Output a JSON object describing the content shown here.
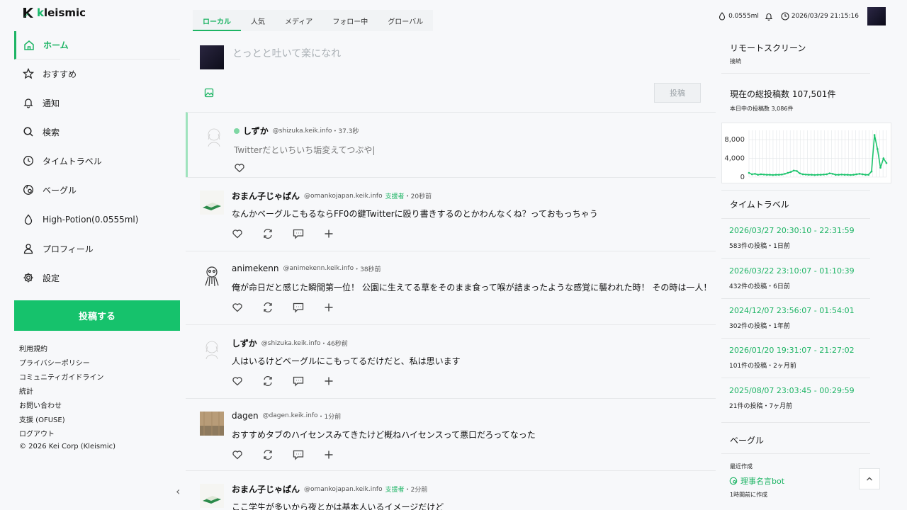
{
  "brand": {
    "logo_k": "k",
    "logo_rest": "leismic"
  },
  "nav": {
    "home": "ホーム",
    "recommended": "おすすめ",
    "notifications": "通知",
    "search": "検索",
    "time_travel": "タイムトラベル",
    "beagle": "ベーグル",
    "potion": "High-Potion(0.0555ml)",
    "profile": "プロフィール",
    "settings": "設定"
  },
  "post_button": "投稿する",
  "footer": {
    "terms": "利用規約",
    "privacy": "プライバシーポリシー",
    "guidelines": "コミュニティガイドライン",
    "stats": "統計",
    "contact": "お問い合わせ",
    "support": "支援 (OFUSE)",
    "logout": "ログアウト",
    "copyright": "© 2026 Kei Corp (Kleismic)"
  },
  "tabs": [
    "ローカル",
    "人気",
    "メディア",
    "フォロー中",
    "グローバル"
  ],
  "compose": {
    "placeholder": "とっとと吐いて楽になれ",
    "submit": "投稿"
  },
  "posts": [
    {
      "name": "しずか",
      "handle": "@shizuka.keik.info",
      "time": "・37.3秒",
      "text": "Twitterだといちいち垢変えてつぶや|"
    },
    {
      "name": "おまん子じゃぱん",
      "handle": "@omankojapan.keik.info",
      "badge": "支援者",
      "time": "・20秒前",
      "text": "なんかベーグルこもるならFF0の鍵Twitterに殴り書きするのとかわんなくね？っておもっちゃう"
    },
    {
      "name": "animekenn",
      "handle": "@animekenn.keik.info",
      "time": "・38秒前",
      "text": "俺が命日だと感じた瞬間第一位！ 公園に生えてる草をそのまま食って喉が詰まったような感覚に襲われた時！ その時は一人！"
    },
    {
      "name": "しずか",
      "handle": "@shizuka.keik.info",
      "time": "・46秒前",
      "text": "人はいるけどベーグルにこもってるだけだと、私は思います"
    },
    {
      "name": "dagen",
      "handle": "@dagen.keik.info",
      "time": "・1分前",
      "text": "おすすめタブのハイセンスみてきたけど概ねハイセンスって悪口だろってなった"
    },
    {
      "name": "おまん子じゃぱん",
      "handle": "@omankojapan.keik.info",
      "badge": "支援者",
      "time": "・2分前",
      "text": "ここ学生が多いから夜とかは基本人いるイメージだけど"
    }
  ],
  "status": {
    "potion": "0.0555ml",
    "datetime": "2026/03/29 21:15:16"
  },
  "remote": {
    "title": "リモートスクリーン",
    "status": "接続"
  },
  "totals": {
    "title": "現在の総投稿数 107,501件",
    "today": "本日中の投稿数 3,086件"
  },
  "chart_data": {
    "type": "line",
    "yticks": [
      "8,000",
      "4,000",
      "0"
    ],
    "ylim": [
      0,
      10000
    ],
    "grid": true,
    "values": [
      900,
      600,
      700,
      500,
      600,
      550,
      500,
      500,
      450,
      500,
      500,
      550,
      700,
      900,
      1100,
      1400,
      1300,
      800,
      600,
      550,
      500,
      500,
      450,
      500,
      500,
      550,
      600,
      800,
      700,
      500,
      500,
      550,
      500,
      500,
      450,
      500,
      600,
      700,
      600,
      500,
      500,
      1200,
      9000,
      6000,
      2000,
      4000,
      3000
    ]
  },
  "time_travel": {
    "title": "タイムトラベル",
    "entries": [
      {
        "range": "2026/03/27 20:30:10 - 22:31:59",
        "info": "583件の投稿・1日前"
      },
      {
        "range": "2026/03/22 23:10:07 - 01:10:39",
        "info": "432件の投稿・6日前"
      },
      {
        "range": "2024/12/07 23:56:07 - 01:54:01",
        "info": "302件の投稿・1年前"
      },
      {
        "range": "2026/01/20 19:31:07 - 21:27:02",
        "info": "101件の投稿・2ヶ月前"
      },
      {
        "range": "2025/08/07 23:03:45 - 00:29:59",
        "info": "21件の投稿・7ヶ月前"
      }
    ]
  },
  "beagle": {
    "title": "ベーグル",
    "recent": "最近作成",
    "item": "理事名言bot",
    "item_time": "1時間前に作成"
  },
  "colors": {
    "accent": "#16c26c"
  },
  "icons": [
    "home-icon",
    "star-icon",
    "bell-icon",
    "search-icon",
    "clock-icon",
    "beagle-icon",
    "drop-icon",
    "person-icon",
    "gear-icon",
    "heart-icon",
    "repost-icon",
    "quote-icon",
    "plus-icon",
    "image-icon",
    "chevron-left-icon",
    "chevron-up-icon"
  ]
}
